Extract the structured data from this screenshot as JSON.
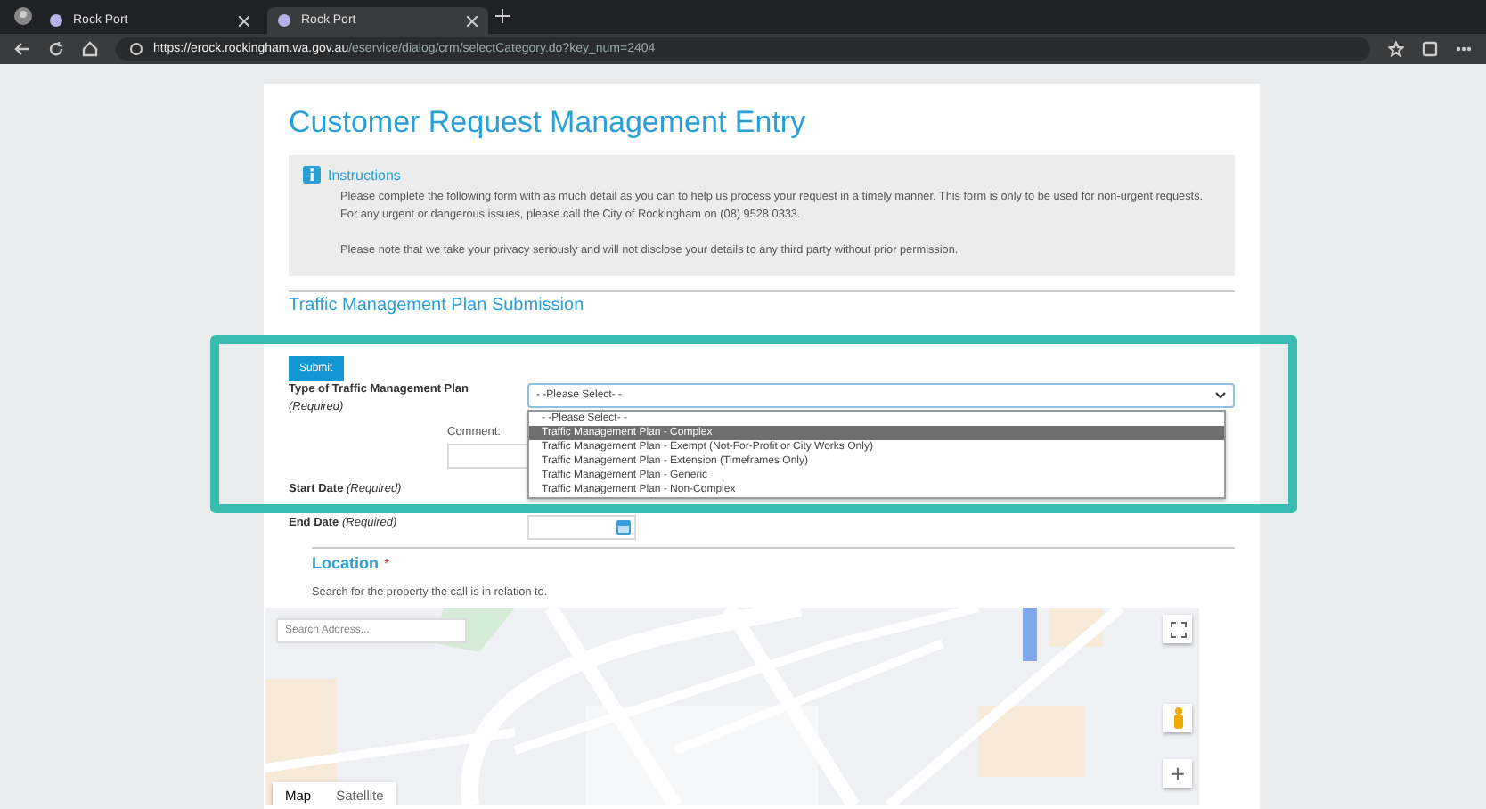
{
  "browser": {
    "tabs": [
      {
        "title": "Rock Port",
        "selected": false
      },
      {
        "title": "Rock Port",
        "selected": true
      }
    ],
    "url_host": "https://erock.rockingham.wa.gov.au",
    "url_path": "/eservice/dialog/crm/selectCategory.do?key_num=2404"
  },
  "page": {
    "title": "Customer Request Management Entry",
    "instructions": {
      "heading": "Instructions",
      "paragraphs": [
        "Please complete the following form with as much detail as you can to help us process your request in a timely manner. This form is only to be used for non-urgent requests. For any urgent or dangerous issues, please call the City of Rockingham on (08) 9528 0333.",
        "Please note that we take your privacy seriously and will not disclose your details to any third party without prior permission."
      ]
    },
    "section_title": "Traffic Management Plan Submission",
    "submit": "Submit",
    "type_field": {
      "label": "Type of Traffic Management Plan",
      "required": "(Required)",
      "value": "- -Please Select- -",
      "expanded": true,
      "options": [
        {
          "label": "- -Please Select- -",
          "highlighted": false
        },
        {
          "label": "Traffic Management Plan - Complex",
          "highlighted": true
        },
        {
          "label": "Traffic Management Plan - Exempt (Not-For-Profit or City Works Only)",
          "highlighted": false
        },
        {
          "label": "Traffic Management Plan - Extension (Timeframes Only)",
          "highlighted": false
        },
        {
          "label": "Traffic Management Plan - Generic",
          "highlighted": false
        },
        {
          "label": "Traffic Management Plan - Non-Complex",
          "highlighted": false
        }
      ]
    },
    "comment_label": "Comment:",
    "start_date": {
      "label": "Start Date",
      "required": "(Required)"
    },
    "end_date": {
      "label": "End Date",
      "required": "(Required)"
    },
    "location": {
      "heading": "Location",
      "required_mark": "*",
      "hint": "Search for the property the call is in relation to.",
      "map": {
        "kind": "picture",
        "search_placeholder": "Search Address...",
        "map_types": [
          {
            "label": "Map",
            "selected": true
          },
          {
            "label": "Satellite",
            "selected": false
          }
        ],
        "zoom_in": "+"
      }
    }
  },
  "highlight": {
    "color": "#38bbb0"
  }
}
